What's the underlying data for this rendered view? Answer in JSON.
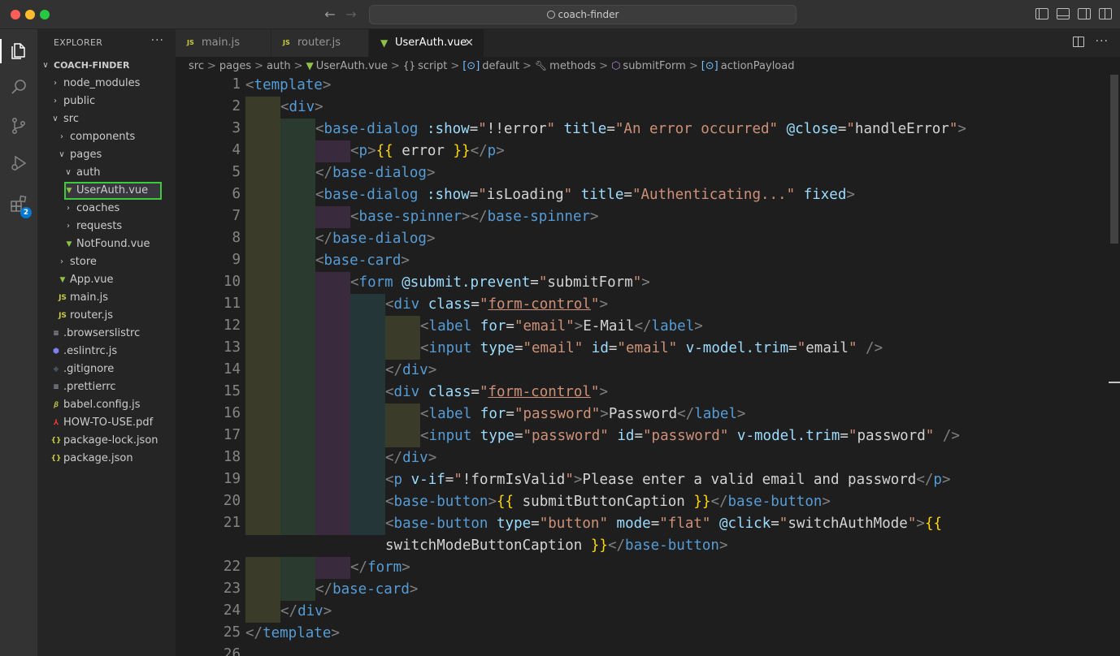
{
  "window": {
    "search_text": "coach-finder"
  },
  "activity_bar": {
    "extensions_badge": "2"
  },
  "explorer": {
    "header": "EXPLORER",
    "more": "···",
    "root": "COACH-FINDER",
    "items": [
      {
        "label": "node_modules",
        "type": "folder",
        "open": false,
        "depth": 1
      },
      {
        "label": "public",
        "type": "folder",
        "open": false,
        "depth": 1
      },
      {
        "label": "src",
        "type": "folder",
        "open": true,
        "depth": 1
      },
      {
        "label": "components",
        "type": "folder",
        "open": false,
        "depth": 2
      },
      {
        "label": "pages",
        "type": "folder",
        "open": true,
        "depth": 2
      },
      {
        "label": "auth",
        "type": "folder",
        "open": true,
        "depth": 3
      },
      {
        "label": "UserAuth.vue",
        "type": "vue",
        "depth": 3,
        "selected": true
      },
      {
        "label": "coaches",
        "type": "folder",
        "open": false,
        "depth": 3
      },
      {
        "label": "requests",
        "type": "folder",
        "open": false,
        "depth": 3
      },
      {
        "label": "NotFound.vue",
        "type": "vue",
        "depth": 3
      },
      {
        "label": "store",
        "type": "folder",
        "open": false,
        "depth": 2
      },
      {
        "label": "App.vue",
        "type": "vue",
        "depth": 2
      },
      {
        "label": "main.js",
        "type": "js",
        "depth": 2
      },
      {
        "label": "router.js",
        "type": "js",
        "depth": 2
      },
      {
        "label": ".browserslistrc",
        "type": "cfg",
        "depth": 1
      },
      {
        "label": ".eslintrc.js",
        "type": "eslint",
        "depth": 1
      },
      {
        "label": ".gitignore",
        "type": "git",
        "depth": 1
      },
      {
        "label": ".prettierrc",
        "type": "cfg",
        "depth": 1
      },
      {
        "label": "babel.config.js",
        "type": "babel",
        "depth": 1
      },
      {
        "label": "HOW-TO-USE.pdf",
        "type": "pdf",
        "depth": 1
      },
      {
        "label": "package-lock.json",
        "type": "json",
        "depth": 1
      },
      {
        "label": "package.json",
        "type": "json",
        "depth": 1
      }
    ]
  },
  "tabs": [
    {
      "label": "main.js",
      "icon": "JS"
    },
    {
      "label": "router.js",
      "icon": "JS"
    },
    {
      "label": "UserAuth.vue",
      "icon": "vue",
      "active": true
    }
  ],
  "breadcrumbs": [
    "src",
    "pages",
    "auth",
    "UserAuth.vue",
    "script",
    "default",
    "methods",
    "submitForm",
    "actionPayload"
  ],
  "editor": {
    "line_numbers": [
      "1",
      "2",
      "3",
      "4",
      "5",
      "6",
      "7",
      "8",
      "9",
      "10",
      "11",
      "12",
      "13",
      "14",
      "15",
      "16",
      "17",
      "18",
      "19",
      "20",
      "21",
      "",
      "22",
      "23",
      "24",
      "25",
      "26"
    ]
  },
  "colors": {
    "selection_outline": "#3ec93e",
    "vue_green": "#8dc149",
    "js_yellow": "#cbcb41",
    "badge_blue": "#0078d4"
  }
}
